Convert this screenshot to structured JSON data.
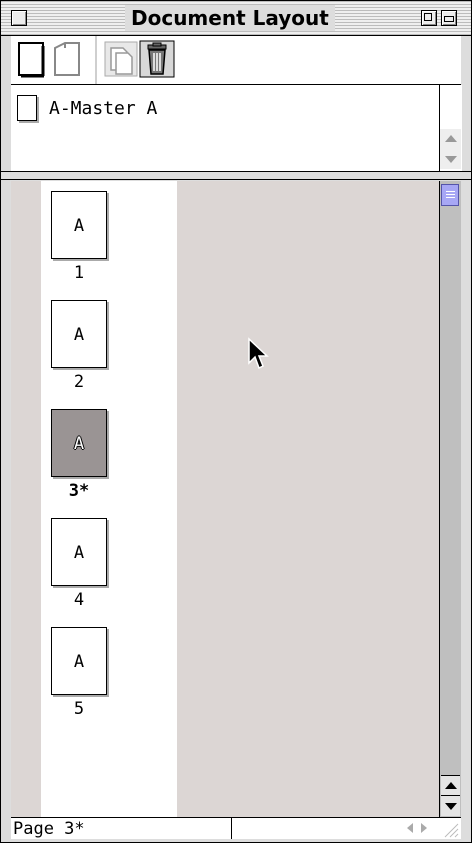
{
  "window": {
    "title": "Document Layout"
  },
  "toolbar": {
    "buttons": [
      {
        "name": "single-sided-page-icon"
      },
      {
        "name": "facing-pages-icon"
      },
      {
        "name": "duplicate-icon"
      },
      {
        "name": "trash-icon"
      }
    ]
  },
  "masters": [
    {
      "label": "A-Master A"
    }
  ],
  "pages": [
    {
      "letter": "A",
      "number": "1",
      "selected": false
    },
    {
      "letter": "A",
      "number": "2",
      "selected": false
    },
    {
      "letter": "A",
      "number": "3*",
      "selected": true
    },
    {
      "letter": "A",
      "number": "4",
      "selected": false
    },
    {
      "letter": "A",
      "number": "5",
      "selected": false
    }
  ],
  "status": {
    "page_text": "Page 3*"
  },
  "colors": {
    "pasteboard": "#dcd6d4",
    "selected_page": "#9a9494",
    "scroll_thumb": "#a7a7f5"
  }
}
